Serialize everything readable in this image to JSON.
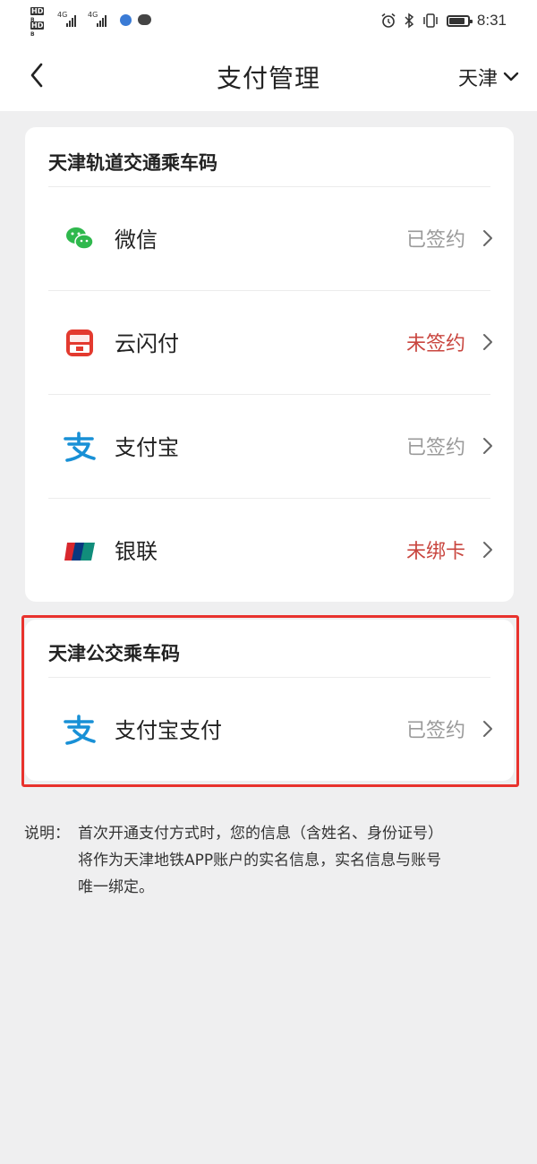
{
  "statusbar": {
    "left_badges": [
      "HD",
      "HD"
    ],
    "network": [
      "4G",
      "4G"
    ],
    "time": "8:31",
    "icons": [
      "alarm-icon",
      "bluetooth-icon",
      "vibrate-icon",
      "battery-icon"
    ]
  },
  "navbar": {
    "title": "支付管理",
    "city": "天津",
    "back_icon": "chevron-left-icon",
    "city_icon": "chevron-down-icon"
  },
  "sections": [
    {
      "title": "天津轨道交通乘车码",
      "items": [
        {
          "label": "微信",
          "status": "已签约",
          "icon": "wechat-icon",
          "status_color": "#9a9a9a"
        },
        {
          "label": "云闪付",
          "status": "未签约",
          "icon": "unionpay-quickpass-icon",
          "status_color": "#c9463f"
        },
        {
          "label": "支付宝",
          "status": "已签约",
          "icon": "alipay-icon",
          "status_color": "#9a9a9a"
        },
        {
          "label": "银联",
          "status": "未绑卡",
          "icon": "unionpay-icon",
          "status_color": "#c9463f"
        }
      ]
    },
    {
      "title": "天津公交乘车码",
      "items": [
        {
          "label": "支付宝支付",
          "status": "已签约",
          "icon": "alipay-icon",
          "status_color": "#9a9a9a"
        }
      ]
    }
  ],
  "note": {
    "prefix": "说明：",
    "line1": "首次开通支付方式时，您的信息（含姓名、身份证号）",
    "line2": "将作为天津地铁APP账户的实名信息，实名信息与账号",
    "line3": "唯一绑定。"
  },
  "colors": {
    "accent_red": "#c9463f",
    "highlight_border": "#e8322d",
    "wechat_green": "#2fb84d",
    "alipay_blue": "#1890d6"
  }
}
